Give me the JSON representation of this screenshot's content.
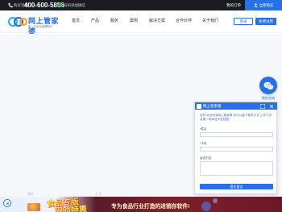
{
  "topbar": {
    "hotline_label": "购买咨询",
    "hotline_number": "400-600-5856",
    "wechat_text": "扫码添加微信",
    "my_orders": "我的订单",
    "login_label": "立即购买"
  },
  "header": {
    "brand": "网上管家婆",
    "slogan": "新一代企业管理软件",
    "nav": [
      "首页",
      "产品",
      "服务",
      "案例",
      "解决方案",
      "合作伙伴",
      "关于我们"
    ],
    "login_button": "登录",
    "try_button": "免费试用"
  },
  "side_widget": {
    "label": "微信咨询"
  },
  "chat": {
    "title": "网上管家婆",
    "message": "您好,欢迎来到网上管家婆,您可以留下联系方式,工作人员会第一时间给予您回复!",
    "fields": [
      {
        "label": "*姓名",
        "placeholder": ""
      },
      {
        "label": "*手机",
        "placeholder": ""
      }
    ],
    "textarea_label": "留言内容",
    "submit": "提交留言"
  },
  "promo": {
    "faded_left": "演示",
    "faded_right": "人工",
    "headline1": "食品专版",
    "headline2": "限时特惠",
    "subline": "专为食品行业打造的进销存软件!"
  },
  "colors": {
    "brand_blue": "#2670e8",
    "topbar_bg": "#1a1c22",
    "promo_red": "#7d1f2c",
    "promo_yellow": "#ffe14a"
  }
}
